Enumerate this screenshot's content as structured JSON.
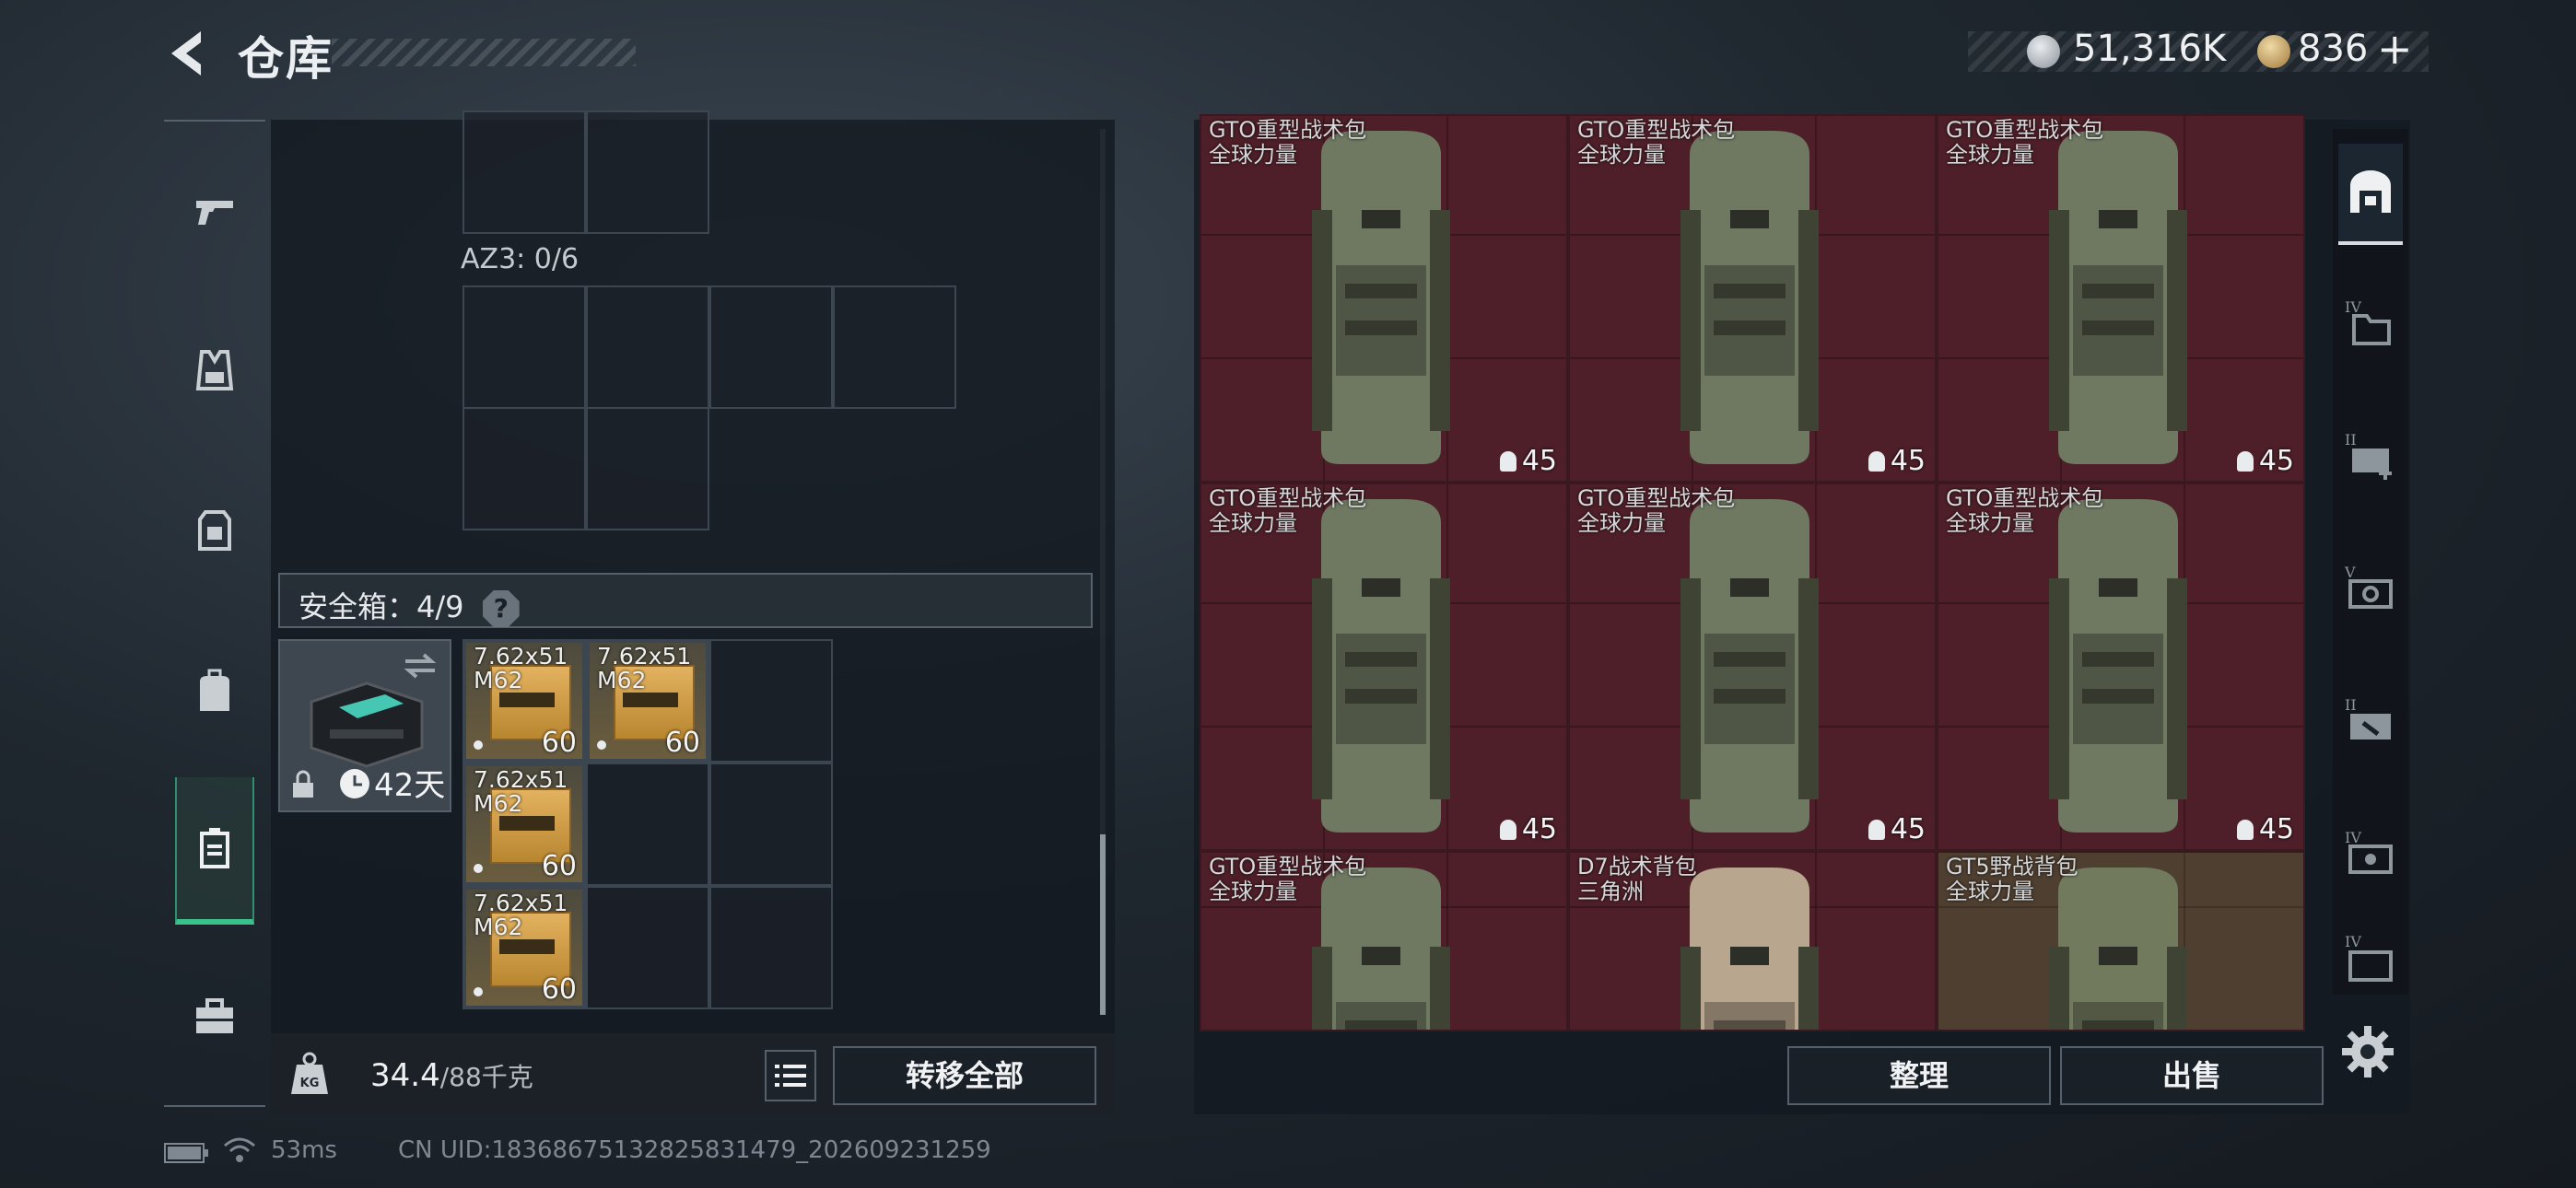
{
  "header": {
    "title": "仓库",
    "back_icon": "back-arrow-icon",
    "currency_silver": "51,316K",
    "currency_gold": "836",
    "plus_label": "+"
  },
  "left_rail": [
    {
      "name": "weapons",
      "icon": "pistol-icon"
    },
    {
      "name": "vest",
      "icon": "vest-icon"
    },
    {
      "name": "armor",
      "icon": "armor-icon"
    },
    {
      "name": "backpack",
      "icon": "backpack-icon"
    },
    {
      "name": "safe-box",
      "icon": "safebox-icon",
      "active": true
    },
    {
      "name": "toolbox",
      "icon": "toolbox-icon"
    }
  ],
  "inventory": {
    "az3_label": "AZ3: 0/6",
    "safe_label": "安全箱：4/9",
    "help_label": "?",
    "safe_days": "42天",
    "ammo": [
      {
        "name": "7.62x51\nM62",
        "count": "60"
      },
      {
        "name": "7.62x51\nM62",
        "count": "60"
      },
      {
        "name": "7.62x51\nM62",
        "count": "60"
      },
      {
        "name": "7.62x51\nM62",
        "count": "60"
      }
    ],
    "weight_value": "34.4",
    "weight_max": "/88千克",
    "transfer_label": "转移全部"
  },
  "stash": {
    "items": [
      {
        "name": "GTO重型战术包",
        "sub": "全球力量",
        "count": "45",
        "color": "#6f7860"
      },
      {
        "name": "GTO重型战术包",
        "sub": "全球力量",
        "count": "45",
        "color": "#6f7860"
      },
      {
        "name": "GTO重型战术包",
        "sub": "全球力量",
        "count": "45",
        "color": "#6f7860"
      },
      {
        "name": "GTO重型战术包",
        "sub": "全球力量",
        "count": "45",
        "color": "#6f7860"
      },
      {
        "name": "GTO重型战术包",
        "sub": "全球力量",
        "count": "45",
        "color": "#6f7860"
      },
      {
        "name": "GTO重型战术包",
        "sub": "全球力量",
        "count": "45",
        "color": "#6f7860"
      },
      {
        "name": "GTO重型战术包",
        "sub": "全球力量",
        "count": "",
        "color": "#6f7860"
      },
      {
        "name": "D7战术背包",
        "sub": "三角洲",
        "count": "",
        "color": "#b8a68e"
      },
      {
        "name": "GT5野战背包",
        "sub": "全球力量",
        "count": "",
        "color": "#727a5e"
      }
    ],
    "sort_label": "整理",
    "sell_label": "出售"
  },
  "filter_rail": [
    {
      "icon": "all-items-icon",
      "tier": ""
    },
    {
      "icon": "folder-icon",
      "tier": "IV"
    },
    {
      "icon": "medkit-icon",
      "tier": "II"
    },
    {
      "icon": "lockbox-icon",
      "tier": "V"
    },
    {
      "icon": "wrench-icon",
      "tier": "II"
    },
    {
      "icon": "crate-icon",
      "tier": "IV"
    },
    {
      "icon": "case-icon",
      "tier": "IV"
    }
  ],
  "status": {
    "ping": "53ms",
    "uid": "CN UID:1836867513282583147​9_202609231259"
  }
}
